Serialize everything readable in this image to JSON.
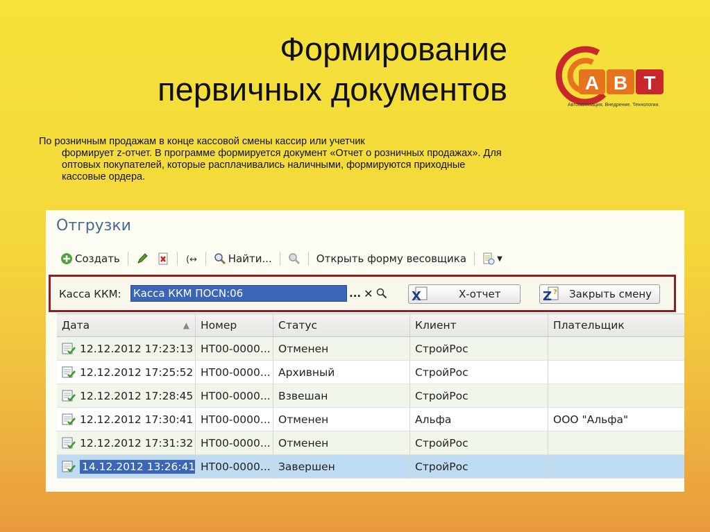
{
  "slide": {
    "title_line1": "Формирование",
    "title_line2": "первичных документов",
    "paragraph_first": "По розничным продажам в конце кассовой смены кассир или учетчик",
    "paragraph_rest": "формирует z-отчет. В программе формируется документ «Отчет о розничных продажах». Для оптовых покупателей, которые расплачивались наличными, формируются приходные кассовые ордера.",
    "logo_text": "АВТ",
    "logo_tagline": "Автоматизация. Внедрение. Технологии."
  },
  "window": {
    "title": "Отгрузки",
    "toolbar": {
      "create": "Создать",
      "find": "Найти...",
      "open_scale_form": "Открыть форму весовщика"
    },
    "kkm": {
      "label": "Касса ККМ:",
      "value": "Касса ККМ ПОСN:06",
      "ellipsis": "...",
      "x_report": "Х-отчет",
      "close_shift": "Закрыть смену"
    },
    "table": {
      "headers": [
        "Дата",
        "Номер",
        "Статус",
        "Клиент",
        "Плательщик"
      ],
      "rows": [
        {
          "date": "12.12.2012 17:23:13",
          "number": "НТ00-0000...",
          "status": "Отменен",
          "client": "СтройРос",
          "payer": ""
        },
        {
          "date": "12.12.2012 17:25:52",
          "number": "НТ00-0000...",
          "status": "Архивный",
          "client": "СтройРос",
          "payer": ""
        },
        {
          "date": "12.12.2012 17:28:45",
          "number": "НТ00-0000...",
          "status": "Взвешан",
          "client": "СтройРос",
          "payer": ""
        },
        {
          "date": "12.12.2012 17:30:41",
          "number": "НТ00-0000...",
          "status": "Отменен",
          "client": "Альфа",
          "payer": "ООО \"Альфа\""
        },
        {
          "date": "12.12.2012 17:31:32",
          "number": "НТ00-0000...",
          "status": "Отменен",
          "client": "СтройРос",
          "payer": ""
        },
        {
          "date": "14.12.2012 13:26:41",
          "number": "НТ00-0000...",
          "status": "Завершен",
          "client": "СтройРос",
          "payer": ""
        }
      ],
      "selected_row": 5
    }
  },
  "colors": {
    "accent_blue": "#3b65b6",
    "frame_red": "#8a1f23",
    "title_blue": "#4a6891",
    "logo_orange": "#e8731e",
    "logo_red": "#c8282b"
  }
}
